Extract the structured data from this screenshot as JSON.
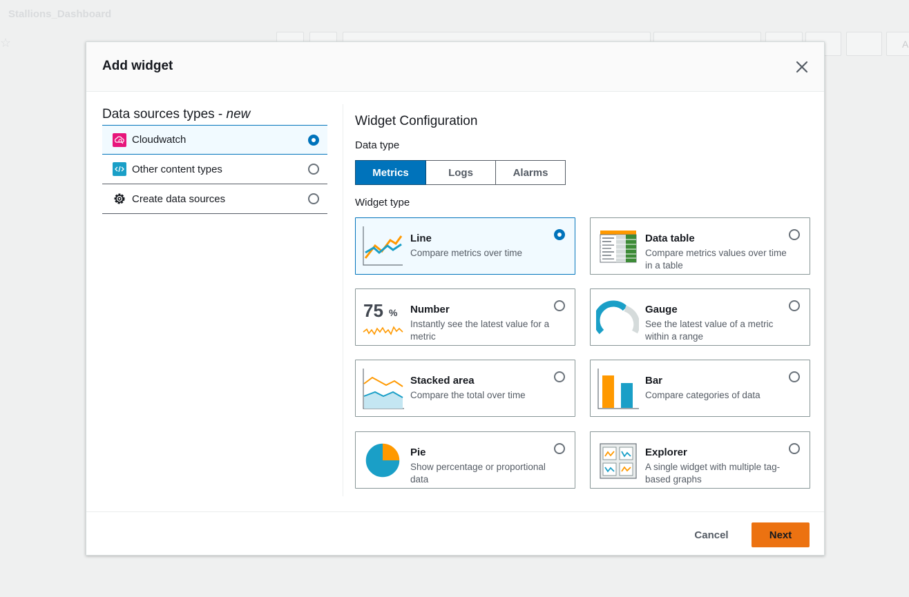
{
  "background": {
    "dashboard_title": "Stallions_Dashboard",
    "toolbar_partial_text": "A"
  },
  "modal": {
    "title": "Add widget",
    "close_icon": "close-icon"
  },
  "data_sources": {
    "title": "Data sources types - ",
    "title_emphasis": "new",
    "items": [
      {
        "label": "Cloudwatch",
        "icon": "cloudwatch-icon",
        "selected": true
      },
      {
        "label": "Other content types",
        "icon": "code-icon",
        "selected": false
      },
      {
        "label": "Create data sources",
        "icon": "gear-icon",
        "selected": false
      }
    ]
  },
  "config": {
    "title": "Widget Configuration",
    "data_type_label": "Data type",
    "data_types": [
      "Metrics",
      "Logs",
      "Alarms"
    ],
    "active_data_type": "Metrics",
    "widget_type_label": "Widget type",
    "widgets": [
      {
        "title": "Line",
        "desc": "Compare metrics over time",
        "icon": "line-chart-icon",
        "selected": true
      },
      {
        "title": "Data table",
        "desc": "Compare metrics values over time in a table",
        "icon": "data-table-icon",
        "selected": false
      },
      {
        "title": "Number",
        "desc": "Instantly see the latest value for a metric",
        "icon": "number-icon",
        "selected": false,
        "thumb_value": "75",
        "thumb_unit": "%"
      },
      {
        "title": "Gauge",
        "desc": "See the latest value of a metric within a range",
        "icon": "gauge-icon",
        "selected": false
      },
      {
        "title": "Stacked area",
        "desc": "Compare the total over time",
        "icon": "stacked-area-icon",
        "selected": false
      },
      {
        "title": "Bar",
        "desc": "Compare categories of data",
        "icon": "bar-chart-icon",
        "selected": false
      },
      {
        "title": "Pie",
        "desc": "Show percentage or proportional data",
        "icon": "pie-chart-icon",
        "selected": false
      },
      {
        "title": "Explorer",
        "desc": "A single widget with multiple tag-based graphs",
        "icon": "explorer-icon",
        "selected": false
      }
    ]
  },
  "footer": {
    "cancel_label": "Cancel",
    "next_label": "Next"
  },
  "colors": {
    "accent_blue": "#0073bb",
    "orange": "#ec7211",
    "chart_orange": "#ff9900",
    "chart_teal": "#1a9fc7"
  }
}
